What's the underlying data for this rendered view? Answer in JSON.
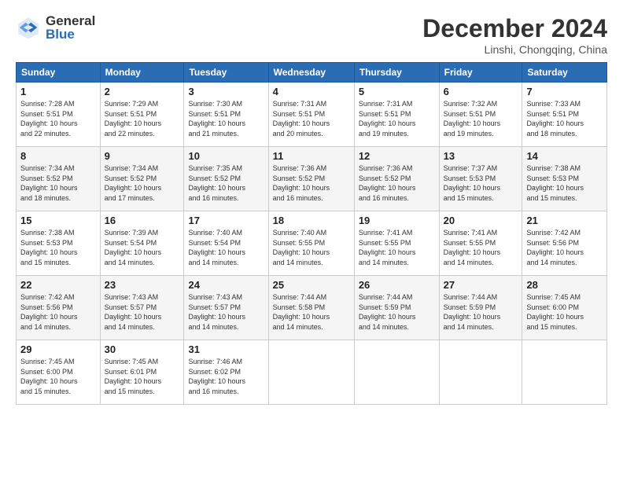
{
  "logo": {
    "general": "General",
    "blue": "Blue"
  },
  "header": {
    "month": "December 2024",
    "location": "Linshi, Chongqing, China"
  },
  "weekdays": [
    "Sunday",
    "Monday",
    "Tuesday",
    "Wednesday",
    "Thursday",
    "Friday",
    "Saturday"
  ],
  "weeks": [
    [
      {
        "day": "1",
        "rise": "7:28 AM",
        "set": "5:51 PM",
        "hours": "10 hours",
        "mins": "22"
      },
      {
        "day": "2",
        "rise": "7:29 AM",
        "set": "5:51 PM",
        "hours": "10 hours",
        "mins": "22"
      },
      {
        "day": "3",
        "rise": "7:30 AM",
        "set": "5:51 PM",
        "hours": "10 hours",
        "mins": "21"
      },
      {
        "day": "4",
        "rise": "7:31 AM",
        "set": "5:51 PM",
        "hours": "10 hours",
        "mins": "20"
      },
      {
        "day": "5",
        "rise": "7:31 AM",
        "set": "5:51 PM",
        "hours": "10 hours",
        "mins": "19"
      },
      {
        "day": "6",
        "rise": "7:32 AM",
        "set": "5:51 PM",
        "hours": "10 hours",
        "mins": "19"
      },
      {
        "day": "7",
        "rise": "7:33 AM",
        "set": "5:51 PM",
        "hours": "10 hours",
        "mins": "18"
      }
    ],
    [
      {
        "day": "8",
        "rise": "7:34 AM",
        "set": "5:52 PM",
        "hours": "10 hours",
        "mins": "18"
      },
      {
        "day": "9",
        "rise": "7:34 AM",
        "set": "5:52 PM",
        "hours": "10 hours",
        "mins": "17"
      },
      {
        "day": "10",
        "rise": "7:35 AM",
        "set": "5:52 PM",
        "hours": "10 hours",
        "mins": "16"
      },
      {
        "day": "11",
        "rise": "7:36 AM",
        "set": "5:52 PM",
        "hours": "10 hours",
        "mins": "16"
      },
      {
        "day": "12",
        "rise": "7:36 AM",
        "set": "5:52 PM",
        "hours": "10 hours",
        "mins": "16"
      },
      {
        "day": "13",
        "rise": "7:37 AM",
        "set": "5:53 PM",
        "hours": "10 hours",
        "mins": "15"
      },
      {
        "day": "14",
        "rise": "7:38 AM",
        "set": "5:53 PM",
        "hours": "10 hours",
        "mins": "15"
      }
    ],
    [
      {
        "day": "15",
        "rise": "7:38 AM",
        "set": "5:53 PM",
        "hours": "10 hours",
        "mins": "15"
      },
      {
        "day": "16",
        "rise": "7:39 AM",
        "set": "5:54 PM",
        "hours": "10 hours",
        "mins": "14"
      },
      {
        "day": "17",
        "rise": "7:40 AM",
        "set": "5:54 PM",
        "hours": "10 hours",
        "mins": "14"
      },
      {
        "day": "18",
        "rise": "7:40 AM",
        "set": "5:55 PM",
        "hours": "10 hours",
        "mins": "14"
      },
      {
        "day": "19",
        "rise": "7:41 AM",
        "set": "5:55 PM",
        "hours": "10 hours",
        "mins": "14"
      },
      {
        "day": "20",
        "rise": "7:41 AM",
        "set": "5:55 PM",
        "hours": "10 hours",
        "mins": "14"
      },
      {
        "day": "21",
        "rise": "7:42 AM",
        "set": "5:56 PM",
        "hours": "10 hours",
        "mins": "14"
      }
    ],
    [
      {
        "day": "22",
        "rise": "7:42 AM",
        "set": "5:56 PM",
        "hours": "10 hours",
        "mins": "14"
      },
      {
        "day": "23",
        "rise": "7:43 AM",
        "set": "5:57 PM",
        "hours": "10 hours",
        "mins": "14"
      },
      {
        "day": "24",
        "rise": "7:43 AM",
        "set": "5:57 PM",
        "hours": "10 hours",
        "mins": "14"
      },
      {
        "day": "25",
        "rise": "7:44 AM",
        "set": "5:58 PM",
        "hours": "10 hours",
        "mins": "14"
      },
      {
        "day": "26",
        "rise": "7:44 AM",
        "set": "5:59 PM",
        "hours": "10 hours",
        "mins": "14"
      },
      {
        "day": "27",
        "rise": "7:44 AM",
        "set": "5:59 PM",
        "hours": "10 hours",
        "mins": "14"
      },
      {
        "day": "28",
        "rise": "7:45 AM",
        "set": "6:00 PM",
        "hours": "10 hours",
        "mins": "15"
      }
    ],
    [
      {
        "day": "29",
        "rise": "7:45 AM",
        "set": "6:00 PM",
        "hours": "10 hours",
        "mins": "15"
      },
      {
        "day": "30",
        "rise": "7:45 AM",
        "set": "6:01 PM",
        "hours": "10 hours",
        "mins": "15"
      },
      {
        "day": "31",
        "rise": "7:46 AM",
        "set": "6:02 PM",
        "hours": "10 hours",
        "mins": "16"
      },
      null,
      null,
      null,
      null
    ]
  ]
}
